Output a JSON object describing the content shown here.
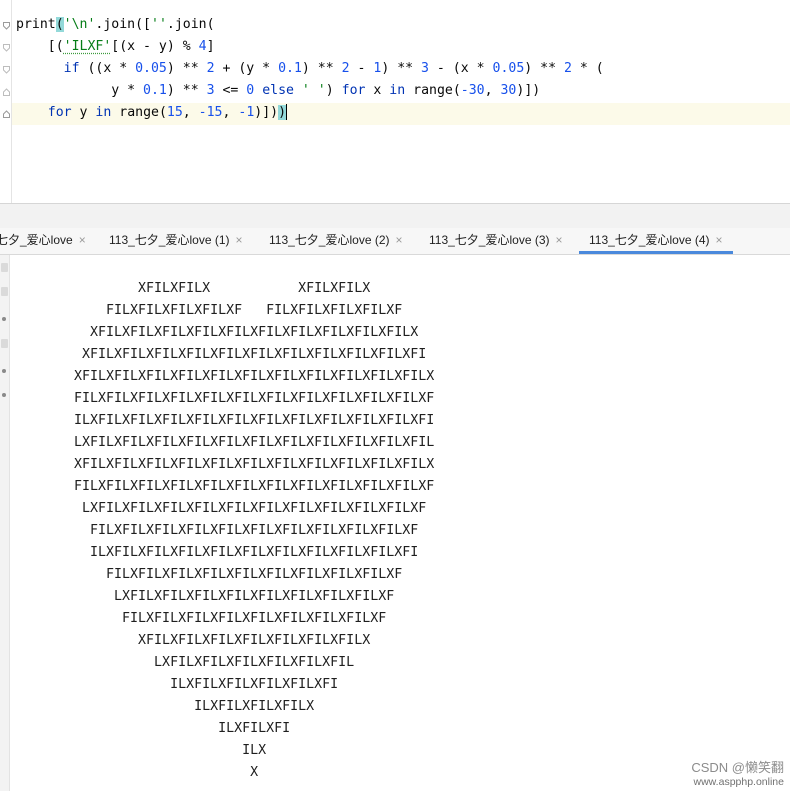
{
  "editor": {
    "lines": [
      [
        {
          "t": "print",
          "c": ""
        },
        {
          "t": "(",
          "c": "bracket"
        },
        {
          "t": "'\\n'",
          "c": "str"
        },
        {
          "t": ".join([",
          "c": ""
        },
        {
          "t": "''",
          "c": "str"
        },
        {
          "t": ".join(",
          "c": ""
        }
      ],
      [
        {
          "t": "    [(",
          "c": ""
        },
        {
          "t": "'ILXF'",
          "c": "str-typo"
        },
        {
          "t": "[(x - y) % ",
          "c": ""
        },
        {
          "t": "4",
          "c": "num"
        },
        {
          "t": "]",
          "c": ""
        }
      ],
      [
        {
          "t": "      ",
          "c": ""
        },
        {
          "t": "if",
          "c": "kw"
        },
        {
          "t": " ((x * ",
          "c": ""
        },
        {
          "t": "0.05",
          "c": "num"
        },
        {
          "t": ") ** ",
          "c": ""
        },
        {
          "t": "2",
          "c": "num"
        },
        {
          "t": " + (y * ",
          "c": ""
        },
        {
          "t": "0.1",
          "c": "num"
        },
        {
          "t": ") ** ",
          "c": ""
        },
        {
          "t": "2",
          "c": "num"
        },
        {
          "t": " - ",
          "c": ""
        },
        {
          "t": "1",
          "c": "num"
        },
        {
          "t": ") ** ",
          "c": ""
        },
        {
          "t": "3",
          "c": "num"
        },
        {
          "t": " - (x * ",
          "c": ""
        },
        {
          "t": "0.05",
          "c": "num"
        },
        {
          "t": ") ** ",
          "c": ""
        },
        {
          "t": "2",
          "c": "num"
        },
        {
          "t": " * (",
          "c": ""
        }
      ],
      [
        {
          "t": "            y * ",
          "c": ""
        },
        {
          "t": "0.1",
          "c": "num"
        },
        {
          "t": ") ** ",
          "c": ""
        },
        {
          "t": "3",
          "c": "num"
        },
        {
          "t": " <= ",
          "c": ""
        },
        {
          "t": "0",
          "c": "num"
        },
        {
          "t": " ",
          "c": ""
        },
        {
          "t": "else",
          "c": "kw"
        },
        {
          "t": " ",
          "c": ""
        },
        {
          "t": "' '",
          "c": "str"
        },
        {
          "t": ") ",
          "c": ""
        },
        {
          "t": "for",
          "c": "kw"
        },
        {
          "t": " x ",
          "c": ""
        },
        {
          "t": "in",
          "c": "kw"
        },
        {
          "t": " range(",
          "c": ""
        },
        {
          "t": "-30",
          "c": "num"
        },
        {
          "t": ", ",
          "c": ""
        },
        {
          "t": "30",
          "c": "num"
        },
        {
          "t": ")])",
          "c": ""
        }
      ],
      [
        {
          "t": "    ",
          "c": ""
        },
        {
          "t": "for",
          "c": "kw"
        },
        {
          "t": " y ",
          "c": ""
        },
        {
          "t": "in",
          "c": "kw"
        },
        {
          "t": " range(",
          "c": ""
        },
        {
          "t": "15",
          "c": "num"
        },
        {
          "t": ", ",
          "c": ""
        },
        {
          "t": "-15",
          "c": "num"
        },
        {
          "t": ", ",
          "c": ""
        },
        {
          "t": "-1",
          "c": "num"
        },
        {
          "t": ")])",
          "c": ""
        },
        {
          "t": ")",
          "c": "bracket"
        }
      ]
    ]
  },
  "tabs": [
    {
      "label": "七夕_爱心love",
      "close": "×"
    },
    {
      "label": "113_七夕_爱心love (1)",
      "close": "×"
    },
    {
      "label": "113_七夕_爱心love (2)",
      "close": "×"
    },
    {
      "label": "113_七夕_爱心love (3)",
      "close": "×"
    },
    {
      "label": "113_七夕_爱心love (4)",
      "close": "×"
    }
  ],
  "console_lines": [
    "        XFILXFILX           XFILXFILX",
    "    FILXFILXFILXFILXF   FILXFILXFILXFILXF",
    "  XFILXFILXFILXFILXFILXFILXFILXFILXFILXFILX",
    " XFILXFILXFILXFILXFILXFILXFILXFILXFILXFILXFI",
    "XFILXFILXFILXFILXFILXFILXFILXFILXFILXFILXFILX",
    "FILXFILXFILXFILXFILXFILXFILXFILXFILXFILXFILXF",
    "ILXFILXFILXFILXFILXFILXFILXFILXFILXFILXFILXFI",
    "LXFILXFILXFILXFILXFILXFILXFILXFILXFILXFILXFIL",
    "XFILXFILXFILXFILXFILXFILXFILXFILXFILXFILXFILX",
    "FILXFILXFILXFILXFILXFILXFILXFILXFILXFILXFILXF",
    " LXFILXFILXFILXFILXFILXFILXFILXFILXFILXFILXF",
    "  FILXFILXFILXFILXFILXFILXFILXFILXFILXFILXF",
    "  ILXFILXFILXFILXFILXFILXFILXFILXFILXFILXFI",
    "    FILXFILXFILXFILXFILXFILXFILXFILXFILXF",
    "     LXFILXFILXFILXFILXFILXFILXFILXFILXF",
    "      FILXFILXFILXFILXFILXFILXFILXFILXF",
    "        XFILXFILXFILXFILXFILXFILXFILX",
    "          LXFILXFILXFILXFILXFILXFIL",
    "            ILXFILXFILXFILXFILXFI",
    "               ILXFILXFILXFILX",
    "                  ILXFILXFI",
    "                     ILX",
    "                      X"
  ],
  "watermark": {
    "line1": "CSDN @懒笑翻",
    "line2": "www.aspphp.online"
  }
}
